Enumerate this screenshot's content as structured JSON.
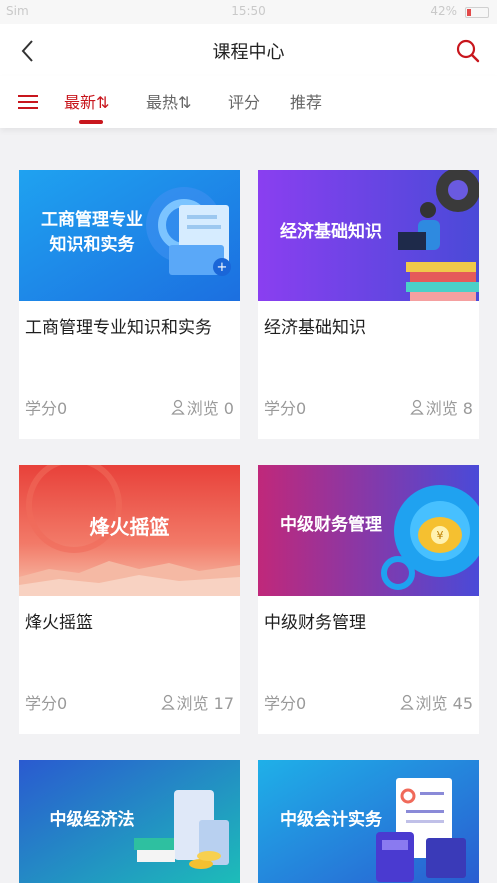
{
  "status_bar": {
    "carrier": "Sim",
    "time": "15:50",
    "right": "42%"
  },
  "header": {
    "title": "课程中心"
  },
  "tabs": [
    {
      "label": "最新⇅",
      "active": true
    },
    {
      "label": "最热⇅",
      "active": false
    },
    {
      "label": "评分",
      "active": false
    },
    {
      "label": "推荐",
      "active": false
    }
  ],
  "courses": [
    {
      "thumb_text": "工商管理专业\n知识和实务",
      "title": "工商管理专业知识和实务",
      "credit": "学分0",
      "views": "浏览 0",
      "icon": "gear-document-icon"
    },
    {
      "thumb_text": "经济基础知识",
      "title": "经济基础知识",
      "credit": "学分0",
      "views": "浏览 8",
      "icon": "reading-person-icon"
    },
    {
      "thumb_text": "烽火摇篮",
      "title": "烽火摇篮",
      "credit": "学分0",
      "views": "浏览 17",
      "icon": "great-wall-icon"
    },
    {
      "thumb_text": "中级财务管理",
      "title": "中级财务管理",
      "credit": "学分0",
      "views": "浏览 45",
      "icon": "money-bag-icon"
    },
    {
      "thumb_text": "中级经济法",
      "title": "",
      "credit": "",
      "views": "",
      "icon": "coins-scroll-icon"
    },
    {
      "thumb_text": "中级会计实务",
      "title": "",
      "credit": "",
      "views": "",
      "icon": "calculator-report-icon"
    }
  ],
  "colors": {
    "accent": "#c8161d",
    "background": "#f2f2f4"
  }
}
